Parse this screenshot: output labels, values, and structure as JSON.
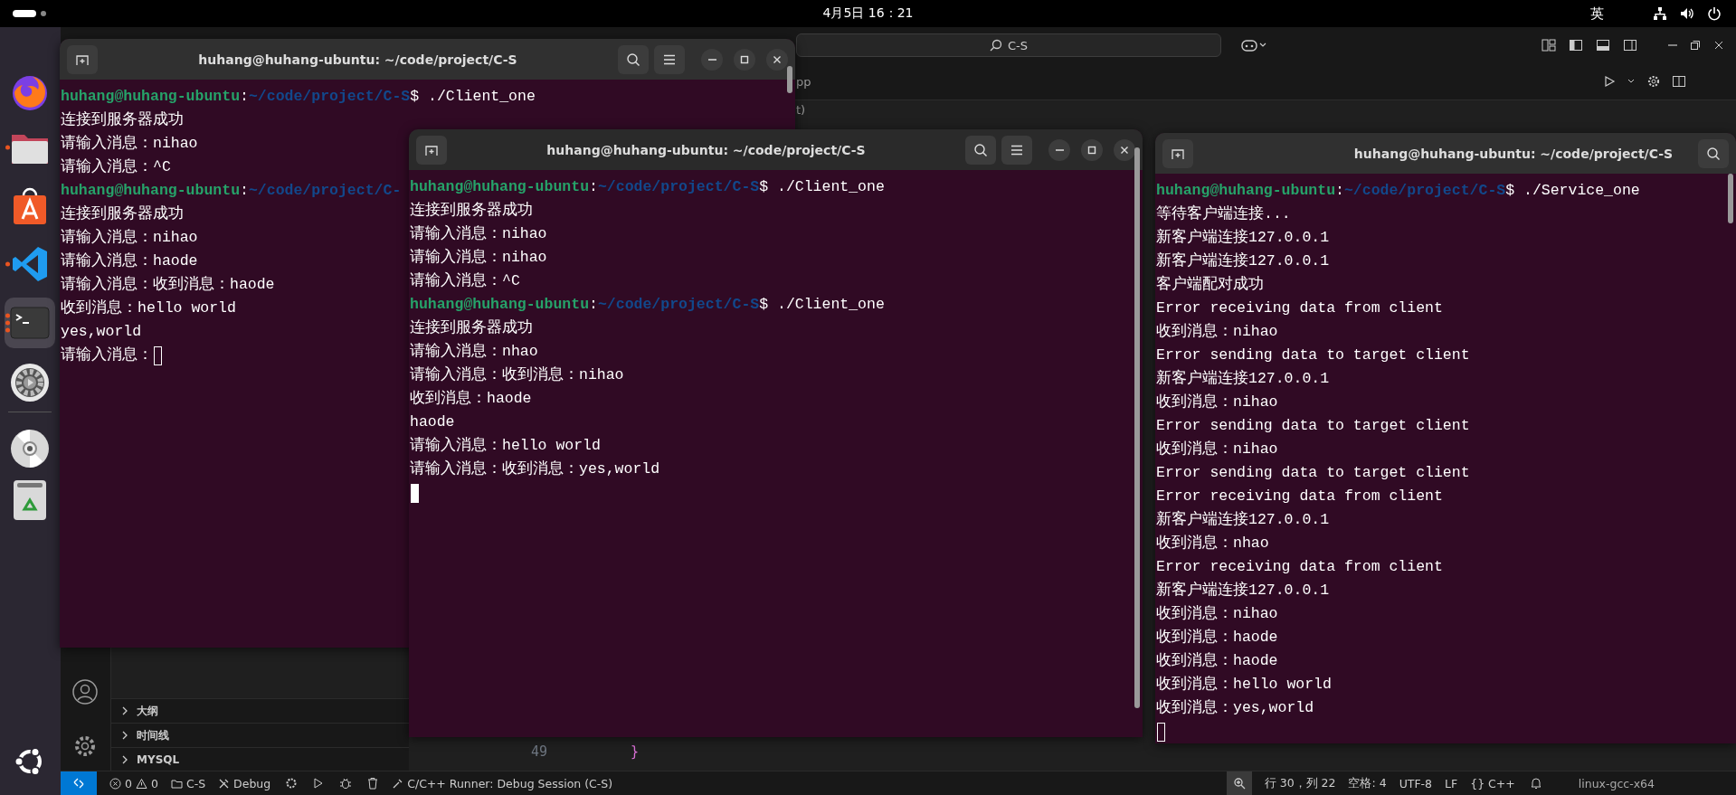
{
  "top_bar": {
    "clock": "4月5日 16：21",
    "input_method": "英"
  },
  "dock": {
    "items": [
      {
        "kind": "browser",
        "running": false,
        "selected": false
      },
      {
        "kind": "files",
        "running": true,
        "multiple_windows": false,
        "selected": false
      },
      {
        "kind": "store",
        "running": false,
        "selected": false
      },
      {
        "kind": "code",
        "running": true,
        "multiple_windows": false,
        "selected": false
      },
      {
        "kind": "terminal",
        "running": true,
        "multiple_windows": true,
        "selected": true
      },
      {
        "kind": "settings",
        "running": false,
        "selected": false
      },
      {
        "kind": "disc",
        "running": false,
        "selected": false
      },
      {
        "kind": "trash",
        "running": false,
        "selected": false
      }
    ]
  },
  "editor": {
    "search": "C-S",
    "tab_fragment": "pp",
    "breadcrumb_fragment": "t)",
    "sidebar_sections": [
      "大纲",
      "时间线",
      "MYSQL"
    ],
    "lines": [
      {
        "number": "49",
        "code": "}"
      }
    ],
    "status_bar": {
      "errors": "0",
      "warnings": "0",
      "workspace": "C-S",
      "debug": "Debug",
      "runner": "C/C++ Runner: Debug Session (C-S)",
      "position": "行 30，列 22",
      "indent": "空格: 4",
      "encoding": "UTF-8",
      "eol": "LF",
      "language": "{} C++",
      "platform": "linux-gcc-x64"
    }
  },
  "terminals": [
    {
      "title": "huhang@huhang-ubuntu: ~/code/project/C-S",
      "focused": false,
      "controls_visible": true,
      "lines": [
        {
          "kind": "prompt",
          "user": "huhang@huhang-ubuntu",
          "colon": ":",
          "path": "~/code/project/C-S",
          "tail": "$ ./Client_one"
        },
        {
          "kind": "output",
          "text": "连接到服务器成功"
        },
        {
          "kind": "output",
          "text": "请输入消息：nihao"
        },
        {
          "kind": "output",
          "text": "请输入消息：^C"
        },
        {
          "kind": "prompt",
          "user": "huhang@huhang-ubuntu",
          "colon": ":",
          "path": "~/code/project/C-"
        },
        {
          "kind": "output",
          "text": "连接到服务器成功"
        },
        {
          "kind": "output",
          "text": "请输入消息：nihao"
        },
        {
          "kind": "output",
          "text": "请输入消息：haode"
        },
        {
          "kind": "output",
          "text": "请输入消息：收到消息：haode"
        },
        {
          "kind": "output",
          "text": "收到消息：hello world"
        },
        {
          "kind": "output",
          "text": "yes,world"
        },
        {
          "kind": "output",
          "text": "请输入消息：",
          "cursor": true
        }
      ]
    },
    {
      "title": "huhang@huhang-ubuntu: ~/code/project/C-S",
      "focused": true,
      "controls_visible": true,
      "lines": [
        {
          "kind": "prompt",
          "user": "huhang@huhang-ubuntu",
          "colon": ":",
          "path": "~/code/project/C-S",
          "tail": "$ ./Client_one"
        },
        {
          "kind": "output",
          "text": "连接到服务器成功"
        },
        {
          "kind": "output",
          "text": "请输入消息：nihao"
        },
        {
          "kind": "output",
          "text": "请输入消息：nihao"
        },
        {
          "kind": "output",
          "text": "请输入消息：^C"
        },
        {
          "kind": "prompt",
          "user": "huhang@huhang-ubuntu",
          "colon": ":",
          "path": "~/code/project/C-S",
          "tail": "$ ./Client_one"
        },
        {
          "kind": "output",
          "text": "连接到服务器成功"
        },
        {
          "kind": "output",
          "text": "请输入消息：nhao"
        },
        {
          "kind": "output",
          "text": "请输入消息：收到消息：nihao"
        },
        {
          "kind": "output",
          "text": "收到消息：haode"
        },
        {
          "kind": "output",
          "text": "haode"
        },
        {
          "kind": "output",
          "text": "请输入消息：hello world"
        },
        {
          "kind": "output",
          "text": "请输入消息：收到消息：yes,world"
        },
        {
          "kind": "cursor"
        }
      ]
    },
    {
      "title": "huhang@huhang-ubuntu: ~/code/project/C-S",
      "focused": false,
      "controls_visible": false,
      "lines": [
        {
          "kind": "prompt",
          "user": "huhang@huhang-ubuntu",
          "colon": ":",
          "path": "~/code/project/C-S",
          "tail": "$ ./Service_one"
        },
        {
          "kind": "output",
          "text": "等待客户端连接..."
        },
        {
          "kind": "output",
          "text": "新客户端连接127.0.0.1"
        },
        {
          "kind": "output",
          "text": "新客户端连接127.0.0.1"
        },
        {
          "kind": "output",
          "text": "客户端配对成功"
        },
        {
          "kind": "output",
          "text": "Error receiving data from client"
        },
        {
          "kind": "output",
          "text": "收到消息：nihao"
        },
        {
          "kind": "output",
          "text": "Error sending data to target client"
        },
        {
          "kind": "output",
          "text": "新客户端连接127.0.0.1"
        },
        {
          "kind": "output",
          "text": "收到消息：nihao"
        },
        {
          "kind": "output",
          "text": "Error sending data to target client"
        },
        {
          "kind": "output",
          "text": "收到消息：nihao"
        },
        {
          "kind": "output",
          "text": "Error sending data to target client"
        },
        {
          "kind": "output",
          "text": "Error receiving data from client"
        },
        {
          "kind": "output",
          "text": "新客户端连接127.0.0.1"
        },
        {
          "kind": "output",
          "text": "收到消息：nhao"
        },
        {
          "kind": "output",
          "text": "Error receiving data from client"
        },
        {
          "kind": "output",
          "text": "新客户端连接127.0.0.1"
        },
        {
          "kind": "output",
          "text": "收到消息：nihao"
        },
        {
          "kind": "output",
          "text": "收到消息：haode"
        },
        {
          "kind": "output",
          "text": "收到消息：haode"
        },
        {
          "kind": "output",
          "text": "收到消息：hello world"
        },
        {
          "kind": "output",
          "text": "收到消息：yes,world"
        },
        {
          "kind": "cursor"
        }
      ]
    }
  ]
}
